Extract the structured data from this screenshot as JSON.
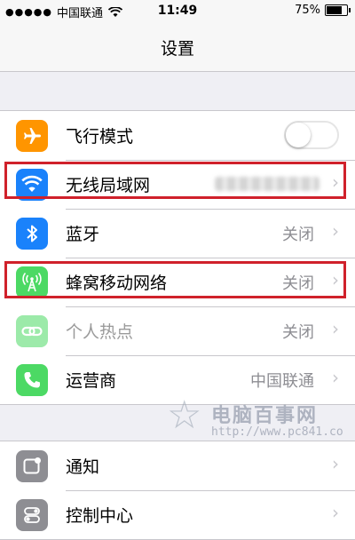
{
  "status_bar": {
    "carrier": "中国联通",
    "time": "11:49",
    "battery": "75%",
    "battery_level": 0.75
  },
  "nav": {
    "title": "设置"
  },
  "groups": [
    {
      "rows": [
        {
          "label": "飞行模式",
          "icon": "airplane-icon",
          "color": "#ff9500",
          "control": "toggle",
          "on": false
        },
        {
          "label": "无线局域网",
          "icon": "wifi-icon",
          "color": "#1a82fb",
          "value_blurred": true
        },
        {
          "label": "蓝牙",
          "icon": "bluetooth-icon",
          "color": "#1a82fb",
          "value": "关闭"
        },
        {
          "label": "蜂窝移动网络",
          "icon": "cellular-antenna-icon",
          "color": "#4cd964",
          "value": "关闭"
        },
        {
          "label": "个人热点",
          "icon": "hotspot-chain-icon",
          "color": "#4cd964",
          "value": "关闭",
          "disabled": true
        },
        {
          "label": "运营商",
          "icon": "phone-icon",
          "color": "#4cd964",
          "value": "中国联通"
        }
      ]
    },
    {
      "rows": [
        {
          "label": "通知",
          "icon": "notifications-icon",
          "color": "#8e8e93"
        },
        {
          "label": "控制中心",
          "icon": "control-center-icon",
          "color": "#8e8e93"
        }
      ]
    }
  ],
  "watermark": {
    "name": "电脑百事网",
    "url": "http://www.pc841.co"
  }
}
